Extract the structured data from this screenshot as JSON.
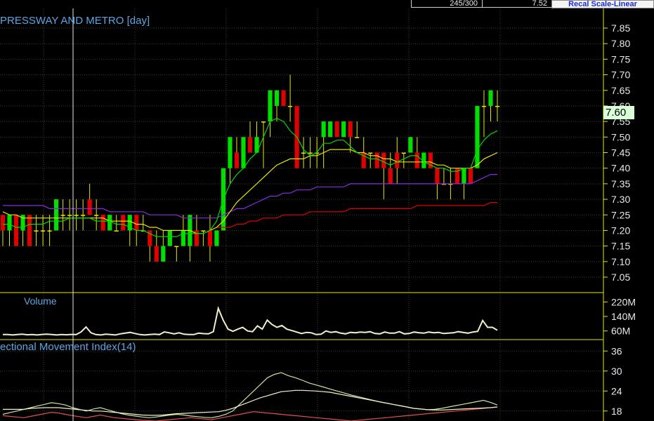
{
  "topbar": {
    "bars_count": "245/300",
    "last_value": "7.52",
    "recal_label": "Recal Scale-Linear"
  },
  "price_panel": {
    "title": "PRESSWAY AND METRO [day]",
    "current_price_label": "7.60",
    "y_ticks": [
      "7.85",
      "7.80",
      "7.75",
      "7.70",
      "7.65",
      "7.60",
      "7.55",
      "7.50",
      "7.45",
      "7.40",
      "7.35",
      "7.30",
      "7.25",
      "7.20",
      "7.15",
      "7.10",
      "7.05"
    ]
  },
  "volume_panel": {
    "title": "Volume",
    "y_ticks": [
      "220M",
      "140M",
      "60M"
    ]
  },
  "dmi_panel": {
    "title": "ectional Movement Index(14)",
    "y_ticks": [
      "36",
      "30",
      "24",
      "18"
    ]
  },
  "colors": {
    "up_candle": "#00e000",
    "down_candle": "#e00000",
    "doji": "#e8e800",
    "ma_short": "#00d800",
    "ma_mid": "#e6e600",
    "ma_long1": "#8a2be2",
    "ma_long2": "#e00000",
    "volume_line": "#f2f0c8",
    "dmi_plus": "#c8e6a0",
    "dmi_minus": "#e05050",
    "dmi_adx": "#f2f0c8",
    "grid": "#3a3a3a",
    "axis": "#e6e600",
    "text": "#5aa6e6"
  },
  "chart_data": [
    {
      "type": "candlestick",
      "title": "PRESSWAY AND METRO [day]",
      "ylim": [
        7.02,
        7.89
      ],
      "y_ticks": [
        7.05,
        7.1,
        7.15,
        7.2,
        7.25,
        7.3,
        7.35,
        7.4,
        7.45,
        7.5,
        7.55,
        7.6,
        7.65,
        7.7,
        7.75,
        7.8,
        7.85
      ],
      "ohlc": [
        [
          7.25,
          7.25,
          7.15,
          7.2
        ],
        [
          7.2,
          7.25,
          7.15,
          7.25
        ],
        [
          7.25,
          7.25,
          7.15,
          7.15
        ],
        [
          7.2,
          7.25,
          7.15,
          7.25
        ],
        [
          7.25,
          7.25,
          7.15,
          7.15
        ],
        [
          7.2,
          7.25,
          7.15,
          7.2
        ],
        [
          7.2,
          7.25,
          7.15,
          7.2
        ],
        [
          7.2,
          7.25,
          7.15,
          7.2
        ],
        [
          7.2,
          7.3,
          7.2,
          7.3
        ],
        [
          7.25,
          7.3,
          7.2,
          7.25
        ],
        [
          7.25,
          7.3,
          7.2,
          7.25
        ],
        [
          7.25,
          7.3,
          7.2,
          7.25
        ],
        [
          7.25,
          7.3,
          7.2,
          7.25
        ],
        [
          7.3,
          7.35,
          7.25,
          7.25
        ],
        [
          7.25,
          7.3,
          7.2,
          7.25
        ],
        [
          7.25,
          7.25,
          7.2,
          7.2
        ],
        [
          7.2,
          7.25,
          7.2,
          7.25
        ],
        [
          7.2,
          7.25,
          7.2,
          7.2
        ],
        [
          7.25,
          7.25,
          7.2,
          7.2
        ],
        [
          7.2,
          7.25,
          7.15,
          7.25
        ],
        [
          7.25,
          7.25,
          7.15,
          7.2
        ],
        [
          7.2,
          7.25,
          7.2,
          7.2
        ],
        [
          7.2,
          7.2,
          7.1,
          7.15
        ],
        [
          7.15,
          7.2,
          7.1,
          7.1
        ],
        [
          7.1,
          7.2,
          7.1,
          7.15
        ],
        [
          7.15,
          7.2,
          7.15,
          7.2
        ],
        [
          7.15,
          7.15,
          7.1,
          7.15
        ],
        [
          7.15,
          7.25,
          7.15,
          7.2
        ],
        [
          7.15,
          7.25,
          7.1,
          7.25
        ],
        [
          7.2,
          7.25,
          7.15,
          7.15
        ],
        [
          7.2,
          7.2,
          7.15,
          7.2
        ],
        [
          7.2,
          7.25,
          7.1,
          7.15
        ],
        [
          7.15,
          7.2,
          7.15,
          7.2
        ],
        [
          7.2,
          7.4,
          7.2,
          7.4
        ],
        [
          7.4,
          7.5,
          7.35,
          7.5
        ],
        [
          7.45,
          7.5,
          7.4,
          7.4
        ],
        [
          7.4,
          7.5,
          7.4,
          7.5
        ],
        [
          7.5,
          7.55,
          7.45,
          7.45
        ],
        [
          7.45,
          7.55,
          7.45,
          7.5
        ],
        [
          7.55,
          7.55,
          7.4,
          7.55
        ],
        [
          7.55,
          7.65,
          7.5,
          7.65
        ],
        [
          7.6,
          7.65,
          7.55,
          7.65
        ],
        [
          7.65,
          7.65,
          7.6,
          7.6
        ],
        [
          7.6,
          7.7,
          7.55,
          7.6
        ],
        [
          7.6,
          7.6,
          7.4,
          7.4
        ],
        [
          7.45,
          7.5,
          7.4,
          7.45
        ],
        [
          7.45,
          7.5,
          7.4,
          7.45
        ],
        [
          7.45,
          7.5,
          7.4,
          7.45
        ],
        [
          7.5,
          7.55,
          7.4,
          7.55
        ],
        [
          7.5,
          7.55,
          7.5,
          7.55
        ],
        [
          7.55,
          7.55,
          7.5,
          7.5
        ],
        [
          7.5,
          7.55,
          7.5,
          7.55
        ],
        [
          7.55,
          7.55,
          7.45,
          7.5
        ],
        [
          7.5,
          7.55,
          7.5,
          7.5
        ],
        [
          7.45,
          7.5,
          7.4,
          7.4
        ],
        [
          7.45,
          7.45,
          7.4,
          7.45
        ],
        [
          7.45,
          7.45,
          7.4,
          7.4
        ],
        [
          7.45,
          7.45,
          7.3,
          7.4
        ],
        [
          7.4,
          7.45,
          7.35,
          7.35
        ],
        [
          7.45,
          7.5,
          7.35,
          7.4
        ],
        [
          7.45,
          7.45,
          7.4,
          7.45
        ],
        [
          7.45,
          7.5,
          7.45,
          7.5
        ],
        [
          7.45,
          7.5,
          7.45,
          7.4
        ],
        [
          7.4,
          7.45,
          7.4,
          7.45
        ],
        [
          7.45,
          7.45,
          7.4,
          7.4
        ],
        [
          7.4,
          7.4,
          7.3,
          7.35
        ],
        [
          7.35,
          7.4,
          7.35,
          7.35
        ],
        [
          7.35,
          7.4,
          7.3,
          7.35
        ],
        [
          7.4,
          7.4,
          7.35,
          7.35
        ],
        [
          7.35,
          7.4,
          7.3,
          7.4
        ],
        [
          7.4,
          7.4,
          7.35,
          7.35
        ],
        [
          7.4,
          7.6,
          7.4,
          7.6
        ],
        [
          7.6,
          7.65,
          7.5,
          7.6
        ],
        [
          7.6,
          7.65,
          7.55,
          7.65
        ],
        [
          7.6,
          7.65,
          7.55,
          7.6
        ]
      ],
      "ma_short": [
        7.22,
        7.22,
        7.21,
        7.21,
        7.22,
        7.22,
        7.22,
        7.23,
        7.23,
        7.23,
        7.24,
        7.24,
        7.24,
        7.24,
        7.23,
        7.23,
        7.23,
        7.22,
        7.22,
        7.21,
        7.2,
        7.2,
        7.19,
        7.18,
        7.18,
        7.18,
        7.18,
        7.19,
        7.19,
        7.19,
        7.19,
        7.2,
        7.23,
        7.3,
        7.35,
        7.38,
        7.4,
        7.43,
        7.45,
        7.5,
        7.55,
        7.56,
        7.55,
        7.52,
        7.5,
        7.46,
        7.44,
        7.45,
        7.48,
        7.48,
        7.49,
        7.49,
        7.47,
        7.45,
        7.44,
        7.43,
        7.43,
        7.42,
        7.41,
        7.42,
        7.43,
        7.44,
        7.44,
        7.42,
        7.41,
        7.4,
        7.4,
        7.39,
        7.39,
        7.4,
        7.4,
        7.46,
        7.49,
        7.51,
        7.52
      ],
      "ma_mid": [
        7.26,
        7.25,
        7.25,
        7.24,
        7.24,
        7.24,
        7.24,
        7.24,
        7.24,
        7.24,
        7.24,
        7.24,
        7.24,
        7.24,
        7.24,
        7.24,
        7.23,
        7.23,
        7.23,
        7.23,
        7.22,
        7.22,
        7.21,
        7.21,
        7.2,
        7.2,
        7.2,
        7.2,
        7.2,
        7.19,
        7.19,
        7.2,
        7.21,
        7.23,
        7.26,
        7.29,
        7.31,
        7.33,
        7.35,
        7.37,
        7.39,
        7.41,
        7.42,
        7.43,
        7.43,
        7.43,
        7.44,
        7.44,
        7.45,
        7.46,
        7.46,
        7.46,
        7.46,
        7.45,
        7.45,
        7.44,
        7.44,
        7.43,
        7.43,
        7.42,
        7.42,
        7.42,
        7.42,
        7.42,
        7.42,
        7.41,
        7.41,
        7.4,
        7.4,
        7.4,
        7.4,
        7.41,
        7.43,
        7.44,
        7.45
      ],
      "ma_long1": [
        7.28,
        7.28,
        7.28,
        7.28,
        7.28,
        7.28,
        7.28,
        7.27,
        7.27,
        7.27,
        7.27,
        7.27,
        7.27,
        7.27,
        7.27,
        7.27,
        7.26,
        7.26,
        7.26,
        7.26,
        7.26,
        7.26,
        7.25,
        7.25,
        7.25,
        7.25,
        7.25,
        7.24,
        7.24,
        7.24,
        7.24,
        7.24,
        7.24,
        7.25,
        7.26,
        7.27,
        7.27,
        7.28,
        7.29,
        7.3,
        7.31,
        7.31,
        7.32,
        7.32,
        7.33,
        7.33,
        7.33,
        7.34,
        7.34,
        7.34,
        7.34,
        7.34,
        7.35,
        7.35,
        7.35,
        7.35,
        7.35,
        7.35,
        7.35,
        7.35,
        7.35,
        7.35,
        7.35,
        7.35,
        7.35,
        7.35,
        7.35,
        7.35,
        7.35,
        7.35,
        7.35,
        7.36,
        7.37,
        7.38,
        7.38
      ],
      "ma_long2": [
        null,
        null,
        null,
        null,
        null,
        null,
        null,
        null,
        null,
        null,
        null,
        null,
        null,
        null,
        null,
        null,
        null,
        null,
        null,
        null,
        null,
        null,
        null,
        null,
        null,
        null,
        null,
        null,
        null,
        null,
        null,
        null,
        7.21,
        7.21,
        7.21,
        7.22,
        7.22,
        7.23,
        7.23,
        7.24,
        7.24,
        7.24,
        7.25,
        7.25,
        7.25,
        7.25,
        7.26,
        7.26,
        7.26,
        7.26,
        7.26,
        7.26,
        7.27,
        7.27,
        7.27,
        7.27,
        7.27,
        7.27,
        7.27,
        7.27,
        7.27,
        7.27,
        7.28,
        7.28,
        7.28,
        7.28,
        7.28,
        7.28,
        7.28,
        7.28,
        7.28,
        7.28,
        7.28,
        7.29,
        7.29
      ]
    },
    {
      "type": "line",
      "title": "Volume",
      "ylim": [
        20,
        260
      ],
      "y_ticks": [
        {
          "value": 220,
          "label": "220M"
        },
        {
          "value": 140,
          "label": "140M"
        },
        {
          "value": 60,
          "label": "60M"
        }
      ],
      "values": [
        40,
        40,
        38,
        40,
        42,
        39,
        40,
        38,
        41,
        42,
        40,
        38,
        40,
        39,
        41,
        40,
        55,
        82,
        50,
        40,
        38,
        42,
        40,
        38,
        44,
        48,
        52,
        46,
        40,
        38,
        40,
        42,
        40,
        55,
        50,
        44,
        50,
        42,
        40,
        40,
        48,
        45,
        44,
        56,
        185,
        120,
        70,
        58,
        70,
        80,
        60,
        56,
        88,
        70,
        120,
        95,
        80,
        90,
        70,
        62,
        54,
        46,
        52,
        50,
        40,
        42,
        60,
        52,
        56,
        48,
        44,
        52,
        50,
        54,
        52,
        56,
        46,
        44,
        54,
        48,
        48,
        56,
        44,
        46,
        54,
        50,
        48,
        54,
        50,
        52,
        46,
        48,
        50,
        56,
        52,
        48,
        54,
        58,
        118,
        80,
        80,
        64
      ]
    },
    {
      "type": "line",
      "title": "ectional Movement Index(14)",
      "ylim": [
        15,
        39
      ],
      "y_ticks": [
        36,
        30,
        24,
        18
      ],
      "series": [
        {
          "values": [
            17,
            17.5,
            18,
            18.5,
            19,
            19.5,
            20,
            20.5,
            20.2,
            19.8,
            19,
            18.5,
            18,
            18.6,
            19,
            18.4,
            17.8,
            17.2,
            16.8,
            16.5,
            16.2,
            16,
            16.2,
            16.5,
            16.8,
            17,
            16.8,
            16.5,
            16.3,
            16.1,
            16,
            16.4,
            17,
            18,
            20,
            22,
            24,
            26,
            28,
            29,
            29.5,
            28.6,
            28,
            27.2,
            26.4,
            25.8,
            25.2,
            24.6,
            24,
            23.4,
            22.8,
            22.3,
            21.8,
            21.3,
            20.8,
            20.4,
            20,
            19.6,
            19.2,
            18.8,
            18.6,
            18.4,
            18.5,
            18.8,
            19.2,
            19.6,
            20,
            20.4,
            20.8,
            21.2,
            20.6,
            19.8
          ]
        },
        {
          "values": [
            16.6,
            16.4,
            16.2,
            16,
            16.4,
            16.8,
            17.2,
            17.6,
            17.4,
            17,
            16.6,
            16.3,
            16,
            16.4,
            16.8,
            16.4,
            16,
            15.8,
            15.6,
            15.4,
            15.2,
            15.1,
            15,
            15.2,
            15.4,
            15.6,
            15.8,
            16,
            15.8,
            15.6,
            15.4,
            15.8,
            16.2,
            16.6,
            17,
            17.4,
            17.8,
            17.6,
            17.4,
            17.2,
            17,
            16.8,
            16.6,
            16.4,
            16.2,
            16,
            15.8,
            15.6,
            15.4,
            15.2,
            15,
            15.2,
            15.4,
            15.6,
            15.8,
            16,
            16.2,
            16.4,
            16.6,
            16.8,
            17,
            17.2,
            17.4,
            17.6,
            17.8,
            18,
            18.2,
            18.4,
            18.6,
            18.8,
            19,
            19.2
          ]
        },
        {
          "values": [
            18.5,
            18.5,
            18.5,
            18.5,
            18.8,
            18.9,
            19,
            19,
            19,
            18.8,
            18.6,
            18.4,
            18.2,
            18,
            18,
            17.8,
            17.6,
            17.4,
            17.2,
            17,
            16.8,
            16.7,
            16.7,
            16.8,
            17,
            17.2,
            17.3,
            17.4,
            17.5,
            17.6,
            17.7,
            17.8,
            18.2,
            18.8,
            19.6,
            20.4,
            21.2,
            22,
            22.6,
            23.2,
            23.8,
            24,
            24.2,
            24.2,
            24.1,
            24,
            23.8,
            23.6,
            23.2,
            22.8,
            22.4,
            22,
            21.6,
            21.2,
            20.8,
            20.4,
            20,
            19.6,
            19.2,
            18.8,
            18.6,
            18.4,
            18.3,
            18.3,
            18.4,
            18.5,
            18.6,
            18.7,
            18.8,
            18.9,
            19,
            19.2
          ]
        }
      ]
    }
  ]
}
